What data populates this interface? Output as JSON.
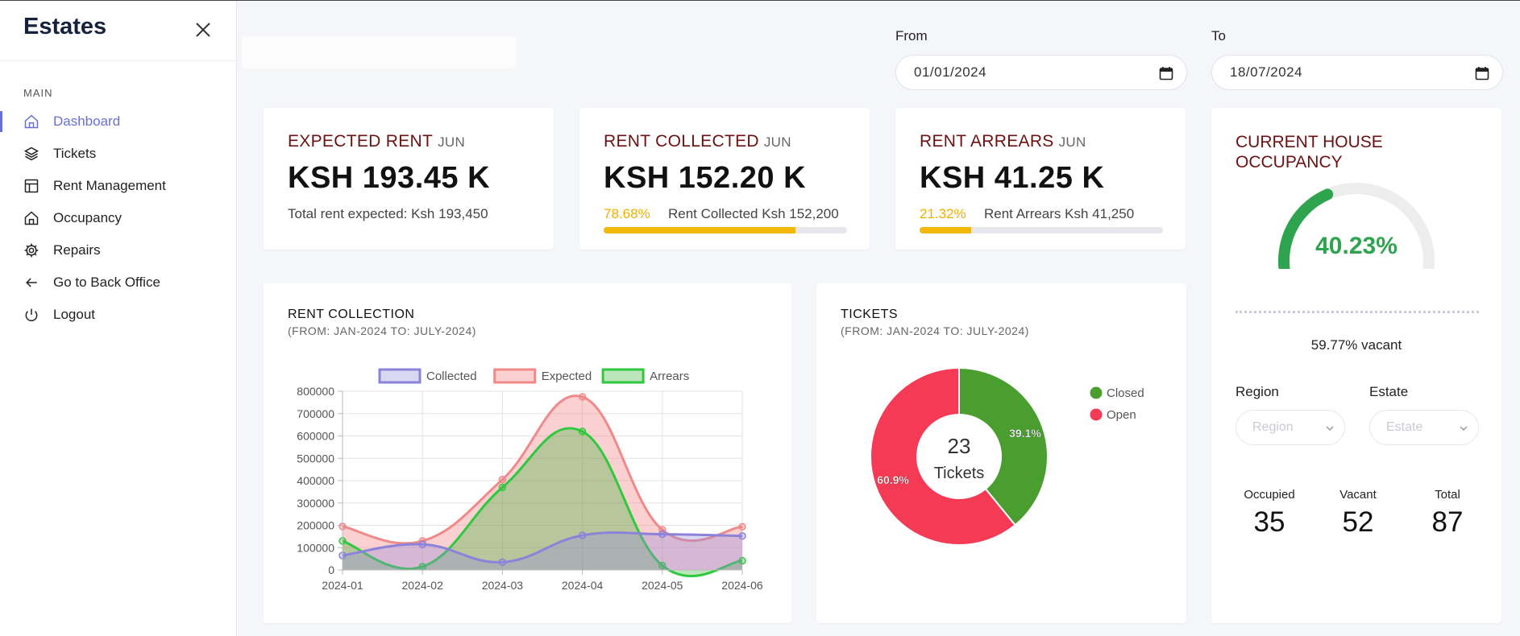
{
  "sidebar": {
    "brand": "Estates",
    "section_label": "MAIN",
    "items": [
      {
        "label": "Dashboard",
        "icon": "home-icon",
        "active": true
      },
      {
        "label": "Tickets",
        "icon": "layers-icon"
      },
      {
        "label": "Rent Management",
        "icon": "layout-icon"
      },
      {
        "label": "Occupancy",
        "icon": "house-icon"
      },
      {
        "label": "Repairs",
        "icon": "gear-icon"
      },
      {
        "label": "Go to Back Office",
        "icon": "arrow-left-icon"
      },
      {
        "label": "Logout",
        "icon": "power-icon"
      }
    ]
  },
  "filters": {
    "from_label": "From",
    "from_value": "01/01/2024",
    "to_label": "To",
    "to_value": "18/07/2024"
  },
  "expected_rent": {
    "title": "EXPECTED RENT",
    "month": "JUN",
    "value": "KSH 193.45 K",
    "sub": "Total rent expected: Ksh 193,450"
  },
  "rent_collected": {
    "title": "RENT COLLECTED",
    "month": "JUN",
    "value": "KSH 152.20 K",
    "percent": "78.68%",
    "progress": 0.7868,
    "sub": "Rent Collected Ksh 152,200"
  },
  "rent_arrears": {
    "title": "RENT ARREARS",
    "month": "JUN",
    "value": "KSH 41.25 K",
    "percent": "21.32%",
    "progress": 0.2132,
    "sub": "Rent Arrears Ksh 41,250"
  },
  "occupancy": {
    "title": "CURRENT HOUSE OCCUPANCY",
    "value_label": "40.23%",
    "fraction": 0.4023,
    "vacant_text": "59.77% vacant",
    "region_label": "Region",
    "region_placeholder": "Region",
    "estate_label": "Estate",
    "estate_placeholder": "Estate",
    "occupied_label": "Occupied",
    "occupied": "35",
    "vacant_label": "Vacant",
    "vacant": "52",
    "total_label": "Total",
    "total": "87"
  },
  "rent_collection": {
    "title": "RENT COLLECTION",
    "subtitle": "(FROM: JAN-2024 TO: JULY-2024)"
  },
  "tickets": {
    "title": "TICKETS",
    "subtitle": "(FROM: JAN-2024 TO: JULY-2024)",
    "center_count": "23",
    "center_label": "Tickets"
  },
  "colors": {
    "accent": "#6770d6",
    "collected": "#8b83d9",
    "expected": "#f08a8a",
    "arrears": "#2ec93e",
    "closed": "#4a9e2f",
    "open": "#f43a55",
    "progress": "#f1b80a"
  },
  "chart_data": [
    {
      "type": "area",
      "categories": [
        "2024-01",
        "2024-02",
        "2024-03",
        "2024-04",
        "2024-05",
        "2024-06"
      ],
      "series": [
        {
          "name": "Collected",
          "values": [
            65000,
            115000,
            35000,
            155000,
            160000,
            152200
          ]
        },
        {
          "name": "Expected",
          "values": [
            195000,
            130000,
            405000,
            775000,
            180000,
            193450
          ]
        },
        {
          "name": "Arrears",
          "values": [
            130000,
            15000,
            370000,
            620000,
            20000,
            41250
          ]
        }
      ],
      "yticks": [
        "800000",
        "700000",
        "600000",
        "500000",
        "400000",
        "300000",
        "200000",
        "100000",
        "0"
      ],
      "ylim": [
        0,
        800000
      ],
      "grid": true,
      "legend": "top"
    },
    {
      "type": "pie",
      "categories": [
        "Closed",
        "Open"
      ],
      "values": [
        39.1,
        60.9
      ],
      "labels": [
        "39.1%",
        "60.9%"
      ],
      "legend": "right"
    }
  ]
}
